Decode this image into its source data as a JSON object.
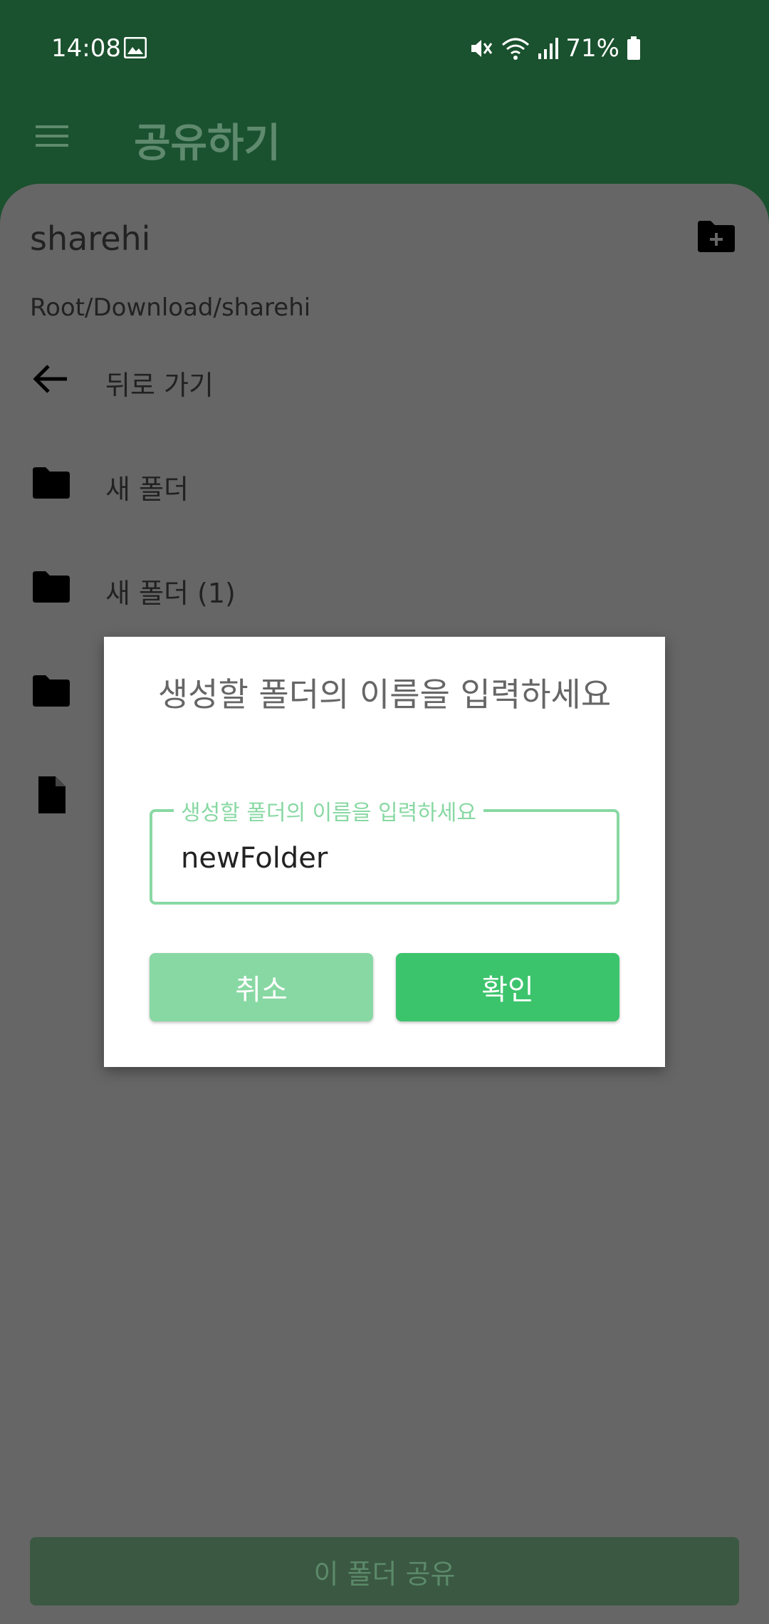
{
  "status_bar": {
    "time": "14:08",
    "battery": "71%"
  },
  "app_bar": {
    "title": "공유하기",
    "menu_icon": "hamburger-menu-icon"
  },
  "browser": {
    "current_folder": "sharehi",
    "path": "Root/Download/sharehi",
    "back_label": "뒤로 가기",
    "items": [
      {
        "label": "새 폴더",
        "icon": "folder-icon"
      },
      {
        "label": "새 폴더 (1)",
        "icon": "folder-icon"
      },
      {
        "label": "",
        "icon": "folder-icon"
      },
      {
        "label": "",
        "icon": "file-icon"
      }
    ],
    "share_button_label": "이 폴더 공유"
  },
  "dialog": {
    "title": "생성할 폴더의 이름을 입력하세요",
    "field_label": "생성할 폴더의 이름을 입력하세요",
    "field_value": "newFolder",
    "cancel_label": "취소",
    "confirm_label": "확인"
  },
  "colors": {
    "app_bar_bg": "#1a512e",
    "accent_green": "#3cc46c",
    "light_green": "#88d8a3"
  }
}
